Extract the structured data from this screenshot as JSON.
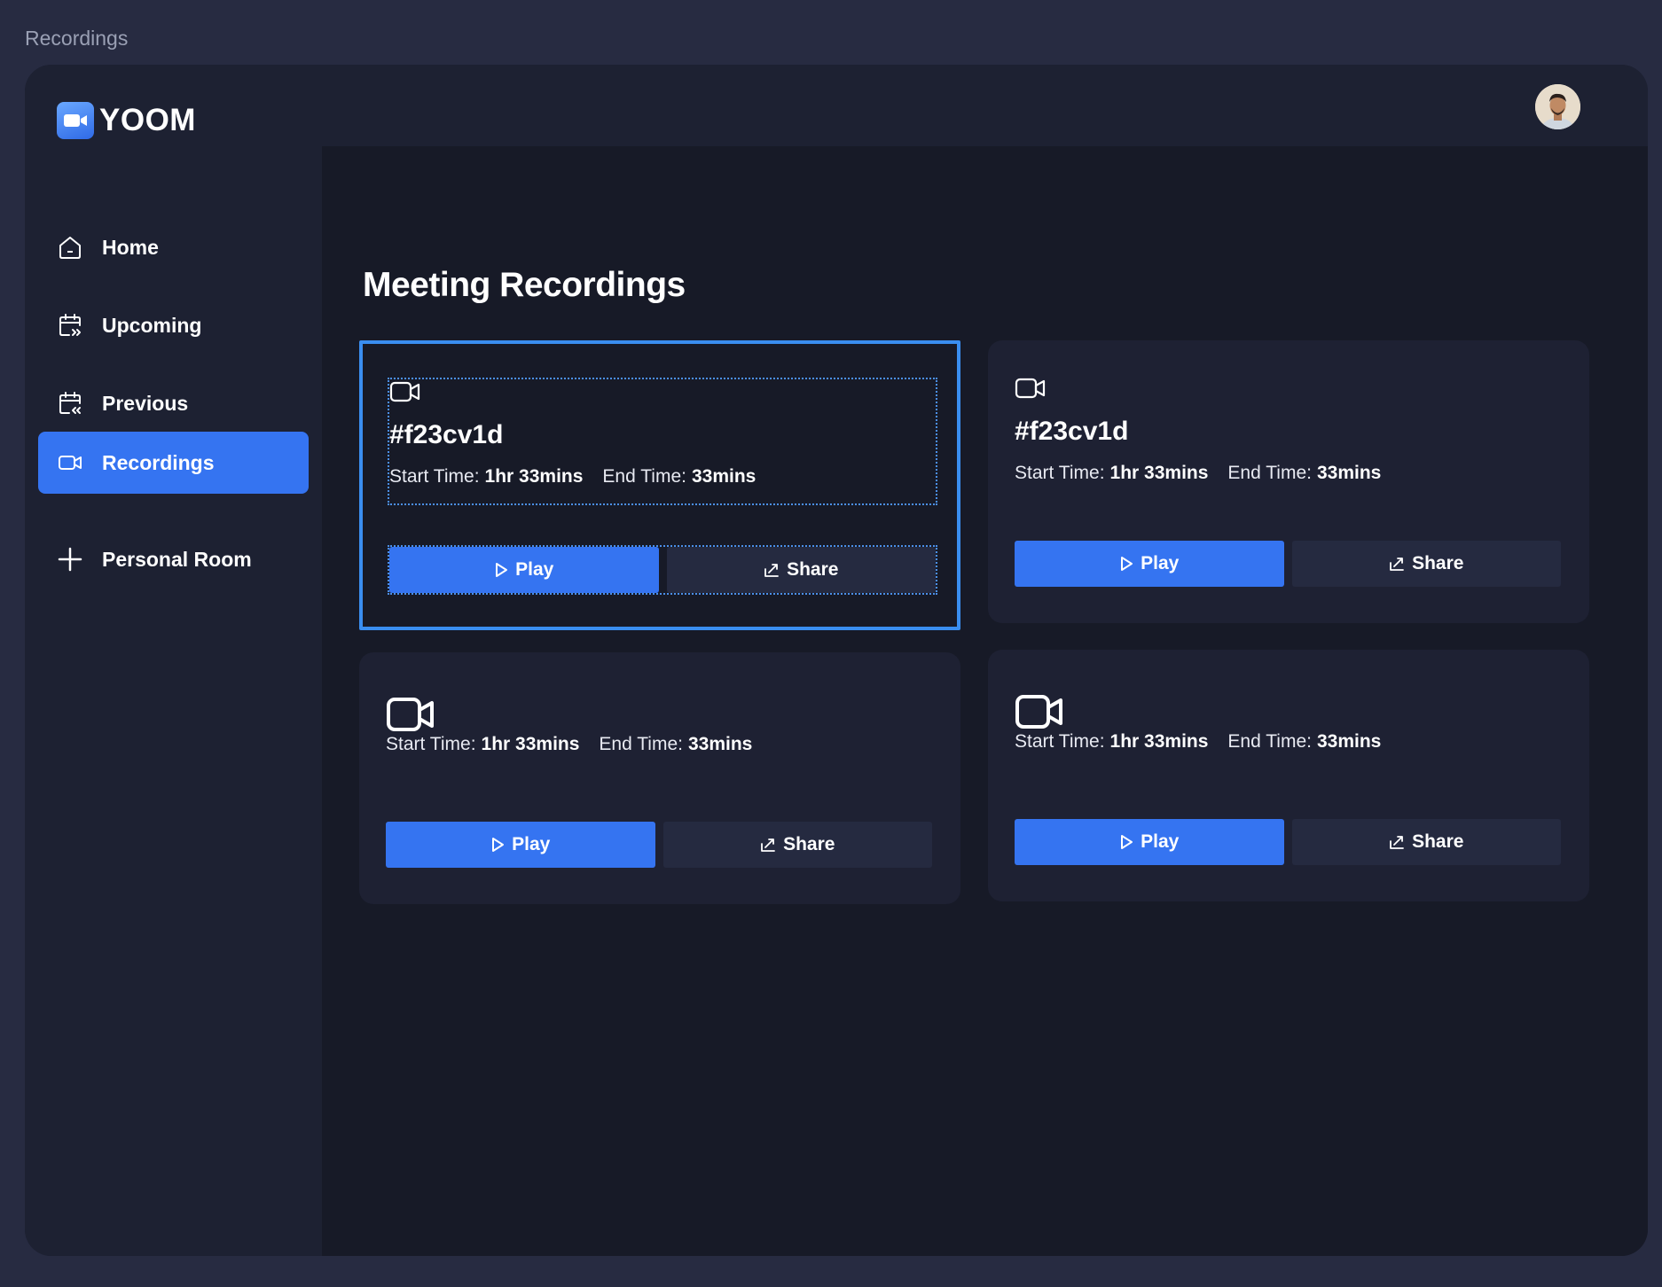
{
  "window_title": "Recordings",
  "brand": {
    "name": "YOOM",
    "accent": "#3574f1"
  },
  "sidebar": {
    "items": [
      {
        "label": "Home",
        "icon": "home-icon",
        "active": false
      },
      {
        "label": "Upcoming",
        "icon": "calendar-upcoming-icon",
        "active": false
      },
      {
        "label": "Previous",
        "icon": "calendar-previous-icon",
        "active": false
      },
      {
        "label": "Recordings",
        "icon": "video-icon",
        "active": true
      },
      {
        "label": "Personal Room",
        "icon": "plus-icon",
        "active": false
      }
    ]
  },
  "main": {
    "title": "Meeting Recordings",
    "cards": [
      {
        "title": "#f23cv1d",
        "start_label": "Start Time:",
        "start_value": "1hr 33mins",
        "end_label": "End Time:",
        "end_value": "33mins",
        "play_label": "Play",
        "share_label": "Share"
      },
      {
        "title": "#f23cv1d",
        "start_label": "Start Time:",
        "start_value": "1hr 33mins",
        "end_label": "End Time:",
        "end_value": "33mins",
        "play_label": "Play",
        "share_label": "Share"
      },
      {
        "title": "",
        "start_label": "Start Time:",
        "start_value": "1hr 33mins",
        "end_label": "End Time:",
        "end_value": "33mins",
        "play_label": "Play",
        "share_label": "Share"
      },
      {
        "title": "",
        "start_label": "Start Time:",
        "start_value": "1hr 33mins",
        "end_label": "End Time:",
        "end_value": "33mins",
        "play_label": "Play",
        "share_label": "Share"
      }
    ]
  }
}
